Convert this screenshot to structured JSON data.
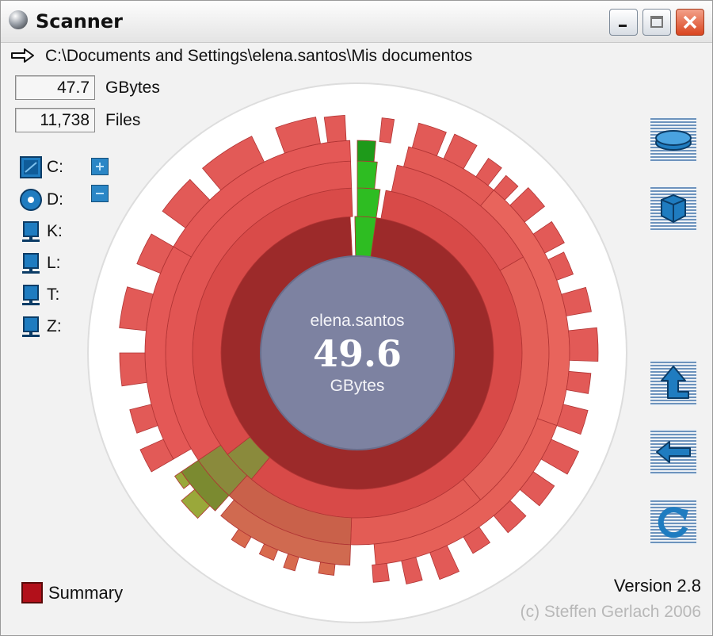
{
  "window": {
    "title": "Scanner"
  },
  "path": "C:\\Documents and Settings\\elena.santos\\Mis documentos",
  "stats": [
    {
      "value": "47.7",
      "label": "GBytes"
    },
    {
      "value": "11,738",
      "label": "Files"
    }
  ],
  "drives": [
    {
      "label": "C:",
      "icon": "hard-drive-icon"
    },
    {
      "label": "D:",
      "icon": "cd-drive-icon"
    },
    {
      "label": "K:",
      "icon": "network-drive-icon"
    },
    {
      "label": "L:",
      "icon": "network-drive-icon"
    },
    {
      "label": "T:",
      "icon": "network-drive-icon"
    },
    {
      "label": "Z:",
      "icon": "network-drive-icon"
    }
  ],
  "zoom_buttons": [
    "plus-icon",
    "minus-icon"
  ],
  "center": {
    "name": "elena.santos",
    "value": "49.6",
    "unit": "GBytes"
  },
  "side_buttons": [
    "disk-icon",
    "box-icon",
    "up-folder-icon",
    "back-arrow-icon",
    "refresh-icon"
  ],
  "summary_label": "Summary",
  "version": "Version 2.8",
  "credit": "(c) Steffen Gerlach 2006",
  "colors": {
    "folder": "#e85a56",
    "folder_dark": "#9c2a2a",
    "selected": "#2ebd22",
    "olive": "#8a8a3c",
    "center": "#7d82a1"
  }
}
